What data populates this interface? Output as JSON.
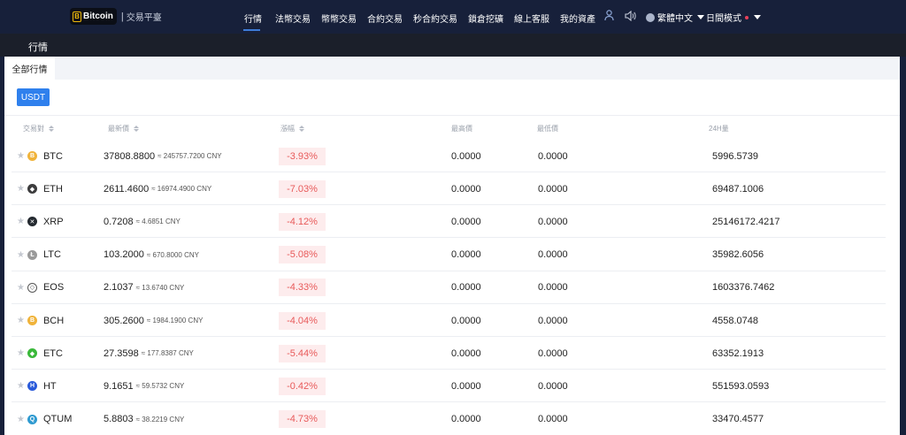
{
  "header": {
    "logo_text": "Bitcoin",
    "logo_separator": "|",
    "logo_subtitle": "交易平臺",
    "nav": [
      {
        "label": "行情",
        "active": true
      },
      {
        "label": "法幣交易"
      },
      {
        "label": "幣幣交易"
      },
      {
        "label": "合約交易"
      },
      {
        "label": "秒合約交易"
      },
      {
        "label": "鎖倉挖礦"
      },
      {
        "label": "線上客服"
      },
      {
        "label": "我的資產"
      }
    ],
    "language": "繁體中文",
    "mode": "日間模式",
    "icons": {
      "user": "user-icon",
      "sound": "speaker-icon",
      "globe": "globe-icon"
    }
  },
  "section": {
    "title": "行情"
  },
  "tabs": {
    "all": "全部行情"
  },
  "market_button": "USDT",
  "table": {
    "headers": {
      "pair": "交易對",
      "latest": "最新價",
      "change": "漲幅",
      "high": "最高價",
      "low": "最低價",
      "volume": "24H量"
    },
    "rows": [
      {
        "symbol": "BTC",
        "price": "37808.8800",
        "cny": "≈ 245757.7200 CNY",
        "change": "-3.93%",
        "high": "0.0000",
        "low": "0.0000",
        "volume": "5996.5739",
        "icon_color": "#f0b33a",
        "icon_glyph": "B"
      },
      {
        "symbol": "ETH",
        "price": "2611.4600",
        "cny": "≈ 16974.4900 CNY",
        "change": "-7.03%",
        "high": "0.0000",
        "low": "0.0000",
        "volume": "69487.1006",
        "icon_color": "#3c3c3d",
        "icon_glyph": "◆"
      },
      {
        "symbol": "XRP",
        "price": "0.7208",
        "cny": "≈ 4.6851 CNY",
        "change": "-4.12%",
        "high": "0.0000",
        "low": "0.0000",
        "volume": "25146172.4217",
        "icon_color": "#23292f",
        "icon_glyph": "✕"
      },
      {
        "symbol": "LTC",
        "price": "103.2000",
        "cny": "≈ 670.8000 CNY",
        "change": "-5.08%",
        "high": "0.0000",
        "low": "0.0000",
        "volume": "35982.6056",
        "icon_color": "#9a9a9a",
        "icon_glyph": "Ł"
      },
      {
        "symbol": "EOS",
        "price": "2.1037",
        "cny": "≈ 13.6740 CNY",
        "change": "-4.33%",
        "high": "0.0000",
        "low": "0.0000",
        "volume": "1603376.7462",
        "icon_color": "#ffffff",
        "icon_glyph": "◇"
      },
      {
        "symbol": "BCH",
        "price": "305.2600",
        "cny": "≈ 1984.1900 CNY",
        "change": "-4.04%",
        "high": "0.0000",
        "low": "0.0000",
        "volume": "4558.0748",
        "icon_color": "#f0b33a",
        "icon_glyph": "B"
      },
      {
        "symbol": "ETC",
        "price": "27.3598",
        "cny": "≈ 177.8387 CNY",
        "change": "-5.44%",
        "high": "0.0000",
        "low": "0.0000",
        "volume": "63352.1913",
        "icon_color": "#3ab83a",
        "icon_glyph": "◆"
      },
      {
        "symbol": "HT",
        "price": "9.1651",
        "cny": "≈ 59.5732 CNY",
        "change": "-0.42%",
        "high": "0.0000",
        "low": "0.0000",
        "volume": "551593.0593",
        "icon_color": "#2a5ada",
        "icon_glyph": "H"
      },
      {
        "symbol": "QTUM",
        "price": "5.8803",
        "cny": "≈ 38.2219 CNY",
        "change": "-4.73%",
        "high": "0.0000",
        "low": "0.0000",
        "volume": "33470.4577",
        "icon_color": "#2e9ad0",
        "icon_glyph": "Q"
      }
    ]
  },
  "colors": {
    "nav_bg": "#17203a",
    "band_bg": "#1b1f2a",
    "accent": "#2f80ed",
    "negative": "#e85a5a",
    "negative_bg": "#fdeced"
  }
}
